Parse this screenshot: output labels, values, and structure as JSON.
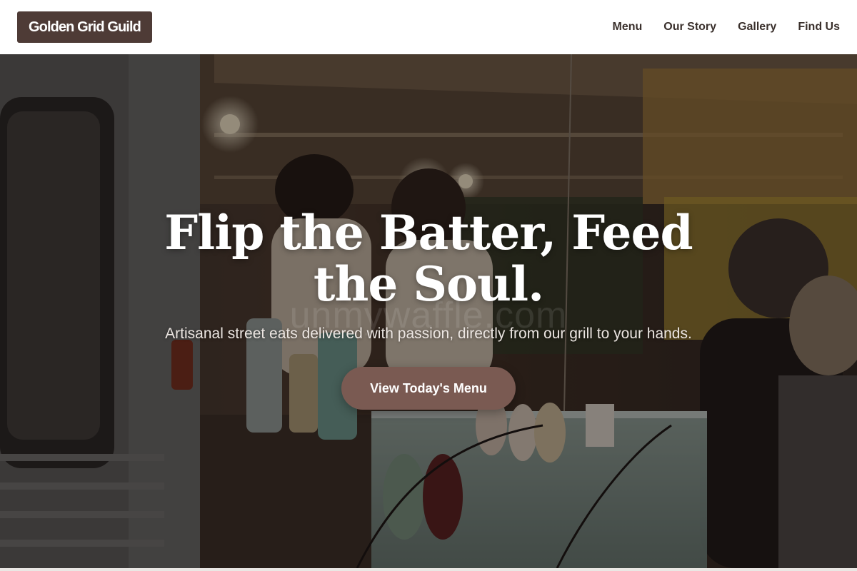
{
  "brand": {
    "name": "Golden Grid Guild"
  },
  "nav": {
    "items": [
      {
        "label": "Menu"
      },
      {
        "label": "Our Story"
      },
      {
        "label": "Gallery"
      },
      {
        "label": "Find Us"
      }
    ]
  },
  "hero": {
    "title": "Flip the Batter, Feed the Soul.",
    "subtitle": "Artisanal street eats delivered with passion, directly from our grill to your hands.",
    "cta_label": "View Today's Menu",
    "watermark": "unmywaffle.com",
    "image_description_icon": "food-truck-photo"
  },
  "colors": {
    "brand_bg": "#4e3b36",
    "cta_bg": "#7a5a52",
    "nav_text": "#3a302c"
  }
}
